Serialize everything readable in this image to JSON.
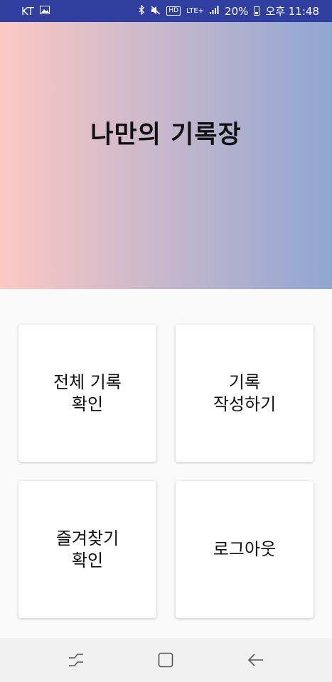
{
  "status_bar": {
    "carrier": "KT",
    "hd_label": "HD",
    "network": "LTE+",
    "battery": "20%",
    "time": "오후 11:48"
  },
  "header": {
    "title": "나만의 기록장"
  },
  "menu": {
    "view_all": "전체 기록\n확인",
    "write": "기록\n작성하기",
    "favorites": "즐겨찾기\n확인",
    "logout": "로그아웃"
  },
  "colors": {
    "status_bar_bg": "#303f9f",
    "gradient_start": "#fdc8c4",
    "gradient_end": "#8fa6d3"
  }
}
